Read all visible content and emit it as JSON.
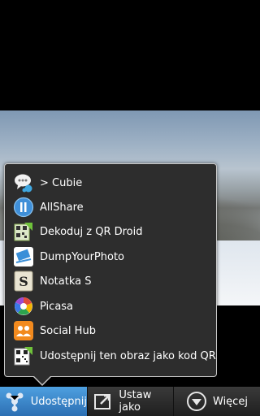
{
  "share_menu": {
    "items": [
      {
        "label": "> Cubie",
        "icon": "cubie-icon"
      },
      {
        "label": "AllShare",
        "icon": "allshare-icon"
      },
      {
        "label": "Dekoduj z QR Droid",
        "icon": "qr-droid-icon"
      },
      {
        "label": "DumpYourPhoto",
        "icon": "dumpyourphoto-icon"
      },
      {
        "label": "Notatka S",
        "icon": "notatka-s-icon"
      },
      {
        "label": "Picasa",
        "icon": "picasa-icon"
      },
      {
        "label": "Social Hub",
        "icon": "social-hub-icon"
      },
      {
        "label": "Udostępnij ten obraz jako kod QR",
        "icon": "qr-code-icon"
      }
    ]
  },
  "action_bar": {
    "share_label": "Udostępnij",
    "set_as_label": "Ustaw jako",
    "more_label": "Więcej"
  }
}
